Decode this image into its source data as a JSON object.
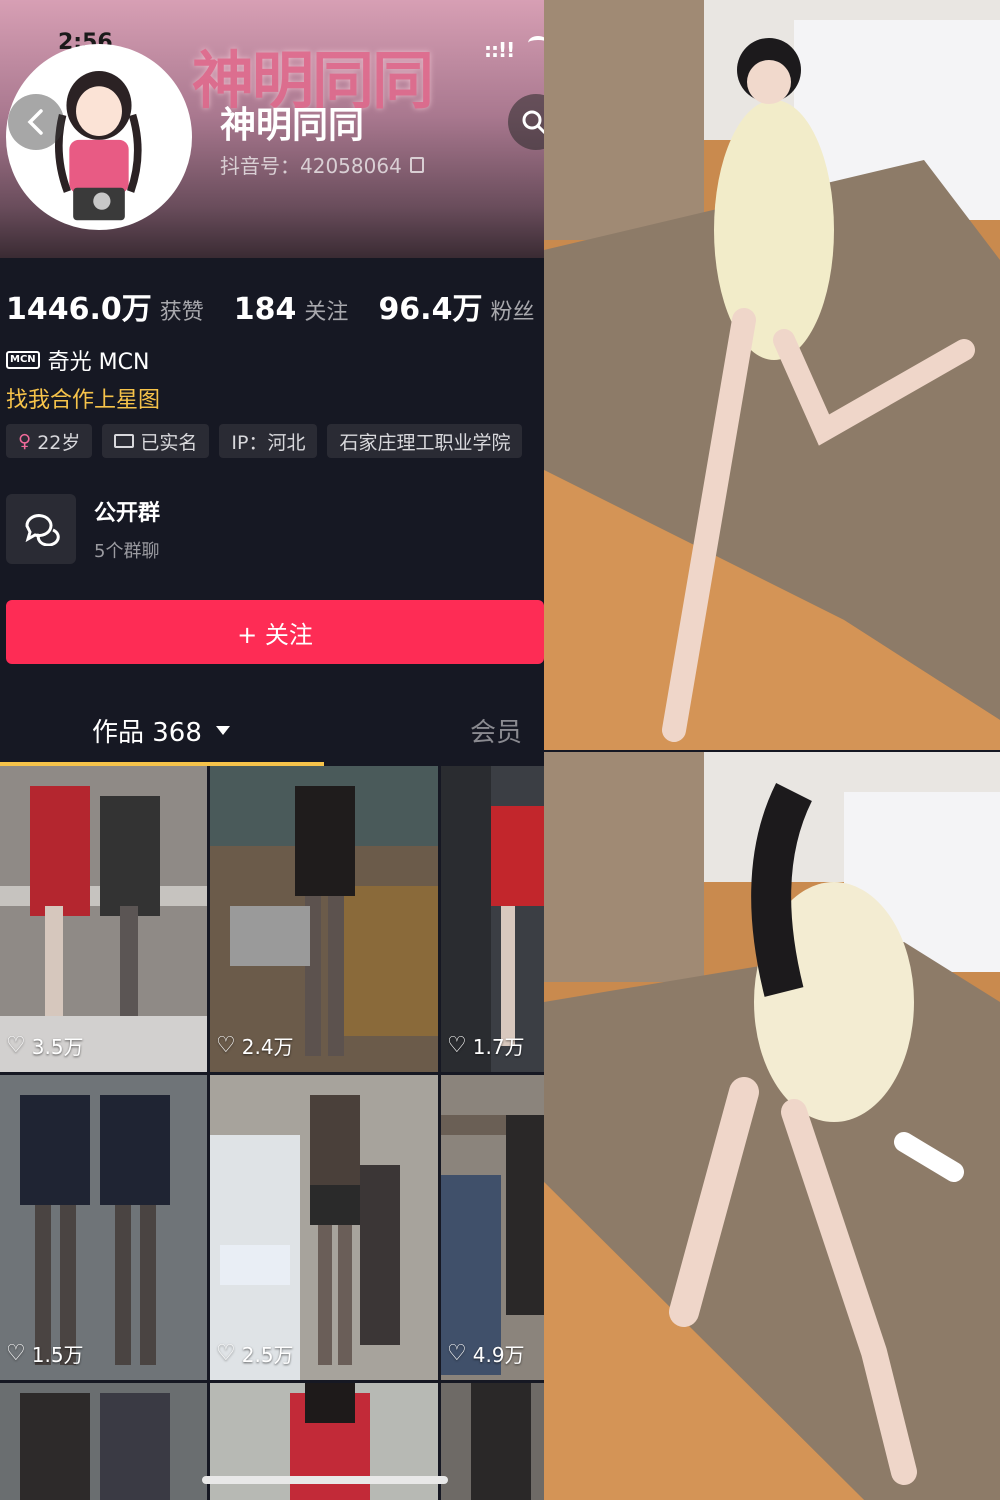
{
  "status_bar": {
    "time": "2:56",
    "signal": "::!!"
  },
  "profile": {
    "watermark": "神明同同",
    "name": "神明同同",
    "douyin_id": "抖音号：42058064"
  },
  "stats": [
    {
      "value": "1446.0万",
      "label": "获赞"
    },
    {
      "value": "184",
      "label": "关注"
    },
    {
      "value": "96.4万",
      "label": "粉丝"
    }
  ],
  "mcn": {
    "badge": "MCN",
    "text": "奇光 MCN"
  },
  "star_link": "找我合作上星图",
  "tags": [
    {
      "icon": "female-icon",
      "text": "22岁"
    },
    {
      "icon": "id-card-icon",
      "text": "已实名"
    },
    {
      "icon": "",
      "text": "IP：河北"
    },
    {
      "icon": "",
      "text": "石家庄理工职业学院"
    }
  ],
  "group": {
    "title": "公开群",
    "subtitle": "5个群聊"
  },
  "follow_button": "+ 关注",
  "tabs": {
    "works": "作品 368",
    "member": "会员"
  },
  "videos": [
    {
      "likes": "3.5万"
    },
    {
      "likes": "2.4万"
    },
    {
      "likes": "1.7万"
    },
    {
      "likes": "1.5万"
    },
    {
      "likes": "2.5万"
    },
    {
      "likes": "4.9万"
    },
    {
      "likes": ""
    },
    {
      "likes": ""
    },
    {
      "likes": ""
    }
  ],
  "colors": {
    "accent": "#fe2c55",
    "star": "#f6c34a",
    "background": "#161823"
  }
}
